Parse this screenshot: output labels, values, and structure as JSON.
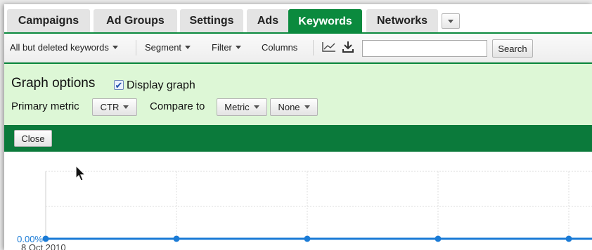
{
  "tabs": [
    {
      "label": "Campaigns",
      "active": false
    },
    {
      "label": "Ad Groups",
      "active": false
    },
    {
      "label": "Settings",
      "active": false
    },
    {
      "label": "Ads",
      "active": false
    },
    {
      "label": "Keywords",
      "active": true
    },
    {
      "label": "Networks",
      "active": false
    }
  ],
  "toolbar": {
    "filter_view": "All but deleted keywords",
    "segment": "Segment",
    "filter": "Filter",
    "columns": "Columns",
    "graph_icon": "line-graph-icon",
    "download_icon": "download-icon",
    "search_value": "",
    "search_button": "Search"
  },
  "graph_options": {
    "title": "Graph options",
    "display_graph_label": "Display graph",
    "display_graph_checked": true,
    "primary_metric_label": "Primary metric",
    "primary_metric_value": "CTR",
    "compare_to_label": "Compare to",
    "compare_metric_value": "Metric",
    "compare_none_value": "None"
  },
  "close_button": "Close",
  "colors": {
    "accent_green": "#0b8a3e",
    "panel_green": "#ddf7d6",
    "series_blue": "#1a7bd6"
  },
  "chart_data": {
    "type": "line",
    "y_tick_labels": [
      "0.00%"
    ],
    "x_tick_labels": [
      "8 Oct 2010"
    ],
    "series": [
      {
        "values": [
          0,
          0,
          0,
          0,
          0,
          0
        ]
      }
    ],
    "ylim": [
      0,
      1
    ],
    "grid": true
  }
}
